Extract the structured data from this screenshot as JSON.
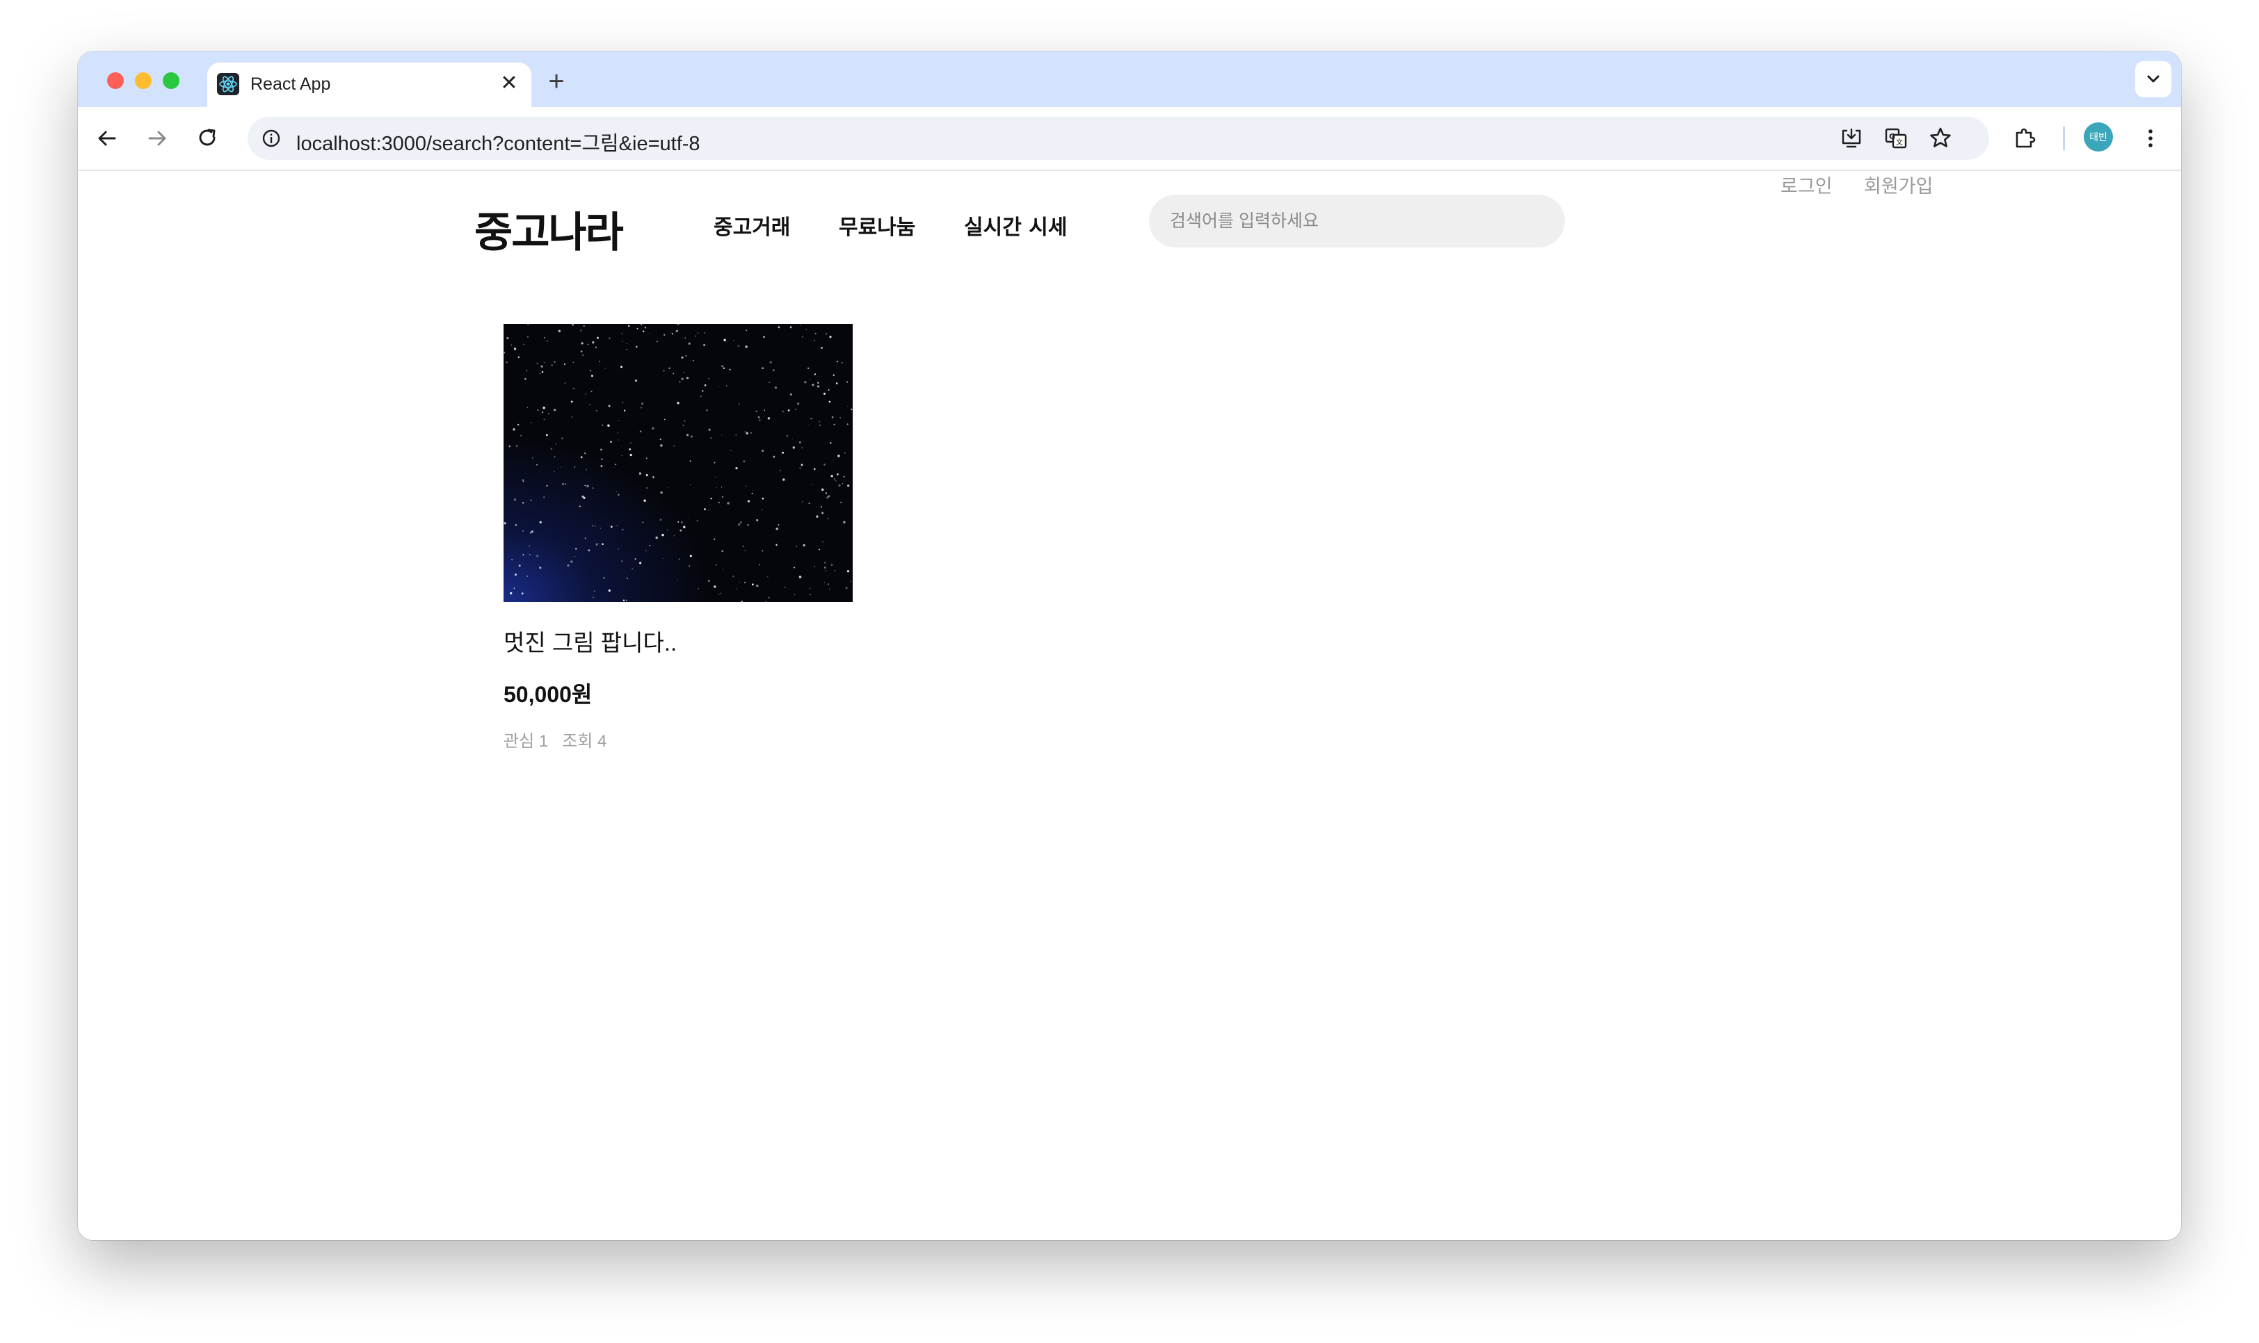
{
  "browser": {
    "tab_title": "React App",
    "url": "localhost:3000/search?content=그림&ie=utf-8",
    "profile_initials": "태빈",
    "icons": [
      "react-favicon",
      "close-icon",
      "plus-icon",
      "chevron-down-icon",
      "back-arrow-icon",
      "forward-arrow-icon",
      "reload-icon",
      "info-icon",
      "install-app-icon",
      "translate-icon",
      "star-icon",
      "extensions-icon",
      "more-vert-icon"
    ]
  },
  "header": {
    "logo": "중고나라",
    "nav": [
      "중고거래",
      "무료나눔",
      "실시간 시세"
    ],
    "search_placeholder": "검색어를 입력하세요",
    "login": "로그인",
    "signup": "회원가입"
  },
  "results": [
    {
      "title": "멋진 그림 팝니다..",
      "price": "50,000원",
      "likes": "관심 1",
      "views": "조회 4"
    }
  ],
  "colors": {
    "tabstrip": "#d3e3fd",
    "omnibox": "#eef1f7",
    "search_bg": "#efefef",
    "meta_text": "#a0a0a0",
    "avatar": "#3aa6b9"
  }
}
